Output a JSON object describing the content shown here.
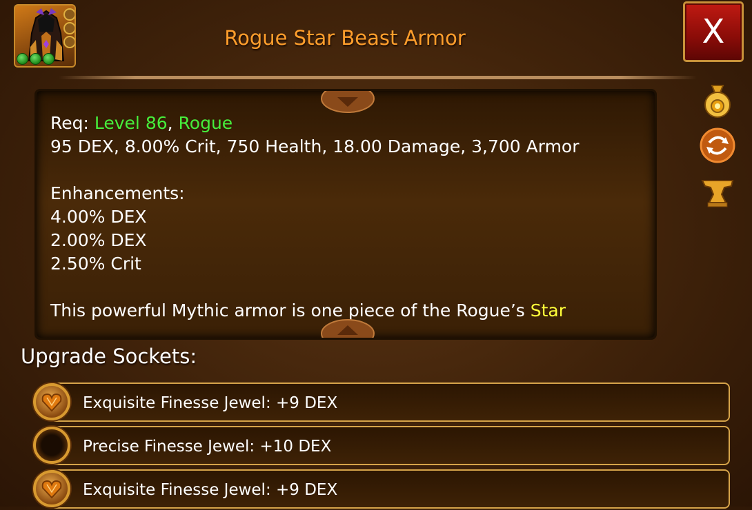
{
  "item": {
    "title": "Rogue Star Beast Armor",
    "gem_count": 3,
    "icon": "hooded-armor-icon"
  },
  "close_label": "X",
  "description": {
    "req_prefix": "Req: ",
    "req_level": "Level 86",
    "req_sep": ", ",
    "req_class": "Rogue",
    "stats": "95 DEX, 8.00% Crit, 750 Health, 18.00 Damage, 3,700 Armor",
    "enhancements_heading": "Enhancements:",
    "enhancements": [
      "4.00% DEX",
      "2.00% DEX",
      "2.50% Crit"
    ],
    "flavor_text": "This powerful Mythic armor is one piece of the Rogue’s ",
    "flavor_highlight": "Star"
  },
  "side_icons": [
    "gold-bag-icon",
    "swap-icon",
    "anvil-icon"
  ],
  "sockets": {
    "heading": "Upgrade Sockets:",
    "items": [
      {
        "label": "Exquisite Finesse Jewel: +9 DEX",
        "gem": "heart-jewel-icon"
      },
      {
        "label": "Precise Finesse Jewel: +10 DEX",
        "gem": "round-jewel-icon"
      },
      {
        "label": "Exquisite Finesse Jewel: +9 DEX",
        "gem": "heart-jewel-icon"
      }
    ]
  },
  "colors": {
    "title": "#ff9e2c",
    "requirement": "#46ee3c",
    "highlight": "#ffff3a",
    "close_button": "#a0100a"
  }
}
